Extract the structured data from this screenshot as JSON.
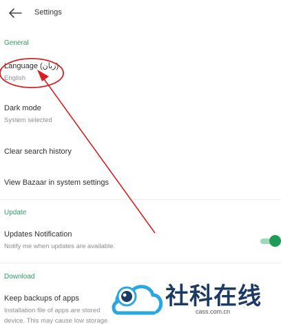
{
  "header": {
    "title": "Settings",
    "back_icon": "arrow-left-icon"
  },
  "sections": {
    "general": {
      "label": "General"
    },
    "update": {
      "label": "Update"
    },
    "download": {
      "label": "Download"
    }
  },
  "general": {
    "language": {
      "title": "Language (زبان)",
      "value": "English"
    },
    "dark_mode": {
      "title": "Dark mode",
      "value": "System selected"
    },
    "clear_search": {
      "title": "Clear search history"
    },
    "view_system": {
      "title": "View Bazaar in system settings"
    }
  },
  "update": {
    "notification": {
      "title": "Updates Notification",
      "description": "Notify me when updates are available.",
      "enabled": true
    }
  },
  "download": {
    "backups": {
      "title": "Keep backups of apps",
      "description_line1": "Installation file of apps are stored",
      "description_line2": "device. This may cause low storage"
    }
  },
  "annotation": {
    "color": "#d62020"
  },
  "watermark": {
    "text": "社科在线",
    "url": "cass.com.cn",
    "colors": {
      "blue": "#2aa7e0",
      "dark": "#1c3a63"
    }
  }
}
